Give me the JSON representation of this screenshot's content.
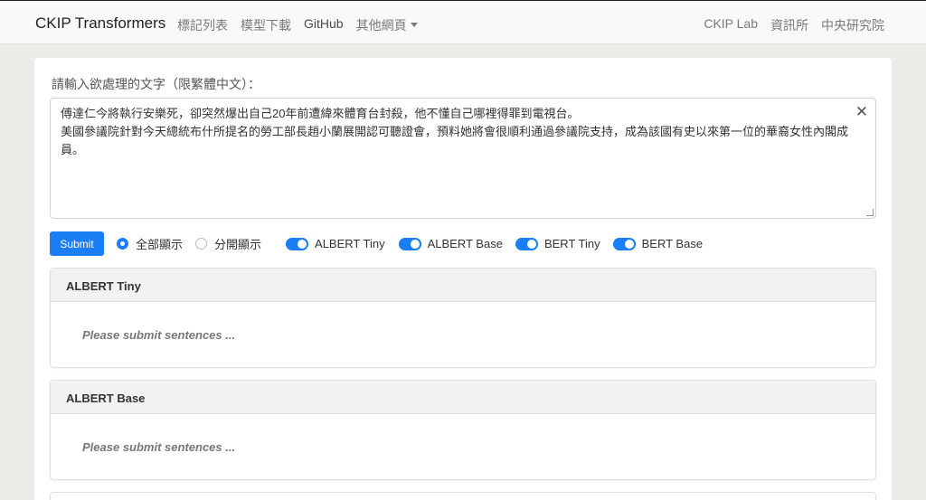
{
  "navbar": {
    "brand": "CKIP Transformers",
    "left_items": [
      "標記列表",
      "模型下載",
      "GitHub",
      "其他網頁"
    ],
    "right_items": [
      "CKIP Lab",
      "資訊所",
      "中央研究院"
    ]
  },
  "form": {
    "prompt_label": "請輸入欲處理的文字（限繁體中文）：",
    "textarea_value": "傅達仁今將執行安樂死，卻突然爆出自己20年前遭緯來體育台封殺，他不懂自己哪裡得罪到電視台。\n美國參議院針對今天總統布什所提名的勞工部長趙小蘭展開認可聽證會，預料她將會很順利通過參議院支持，成為該國有史以來第一位的華裔女性內閣成員。",
    "submit_label": "Submit",
    "radio_options": [
      "全部顯示",
      "分開顯示"
    ],
    "radio_selected": "全部顯示",
    "toggles": [
      "ALBERT Tiny",
      "ALBERT Base",
      "BERT Tiny",
      "BERT Base"
    ]
  },
  "results": [
    {
      "title": "ALBERT Tiny",
      "message": "Please submit sentences ..."
    },
    {
      "title": "ALBERT Base",
      "message": "Please submit sentences ..."
    }
  ],
  "colors": {
    "accent": "#1a7ef5",
    "background": "#ecebe7"
  }
}
